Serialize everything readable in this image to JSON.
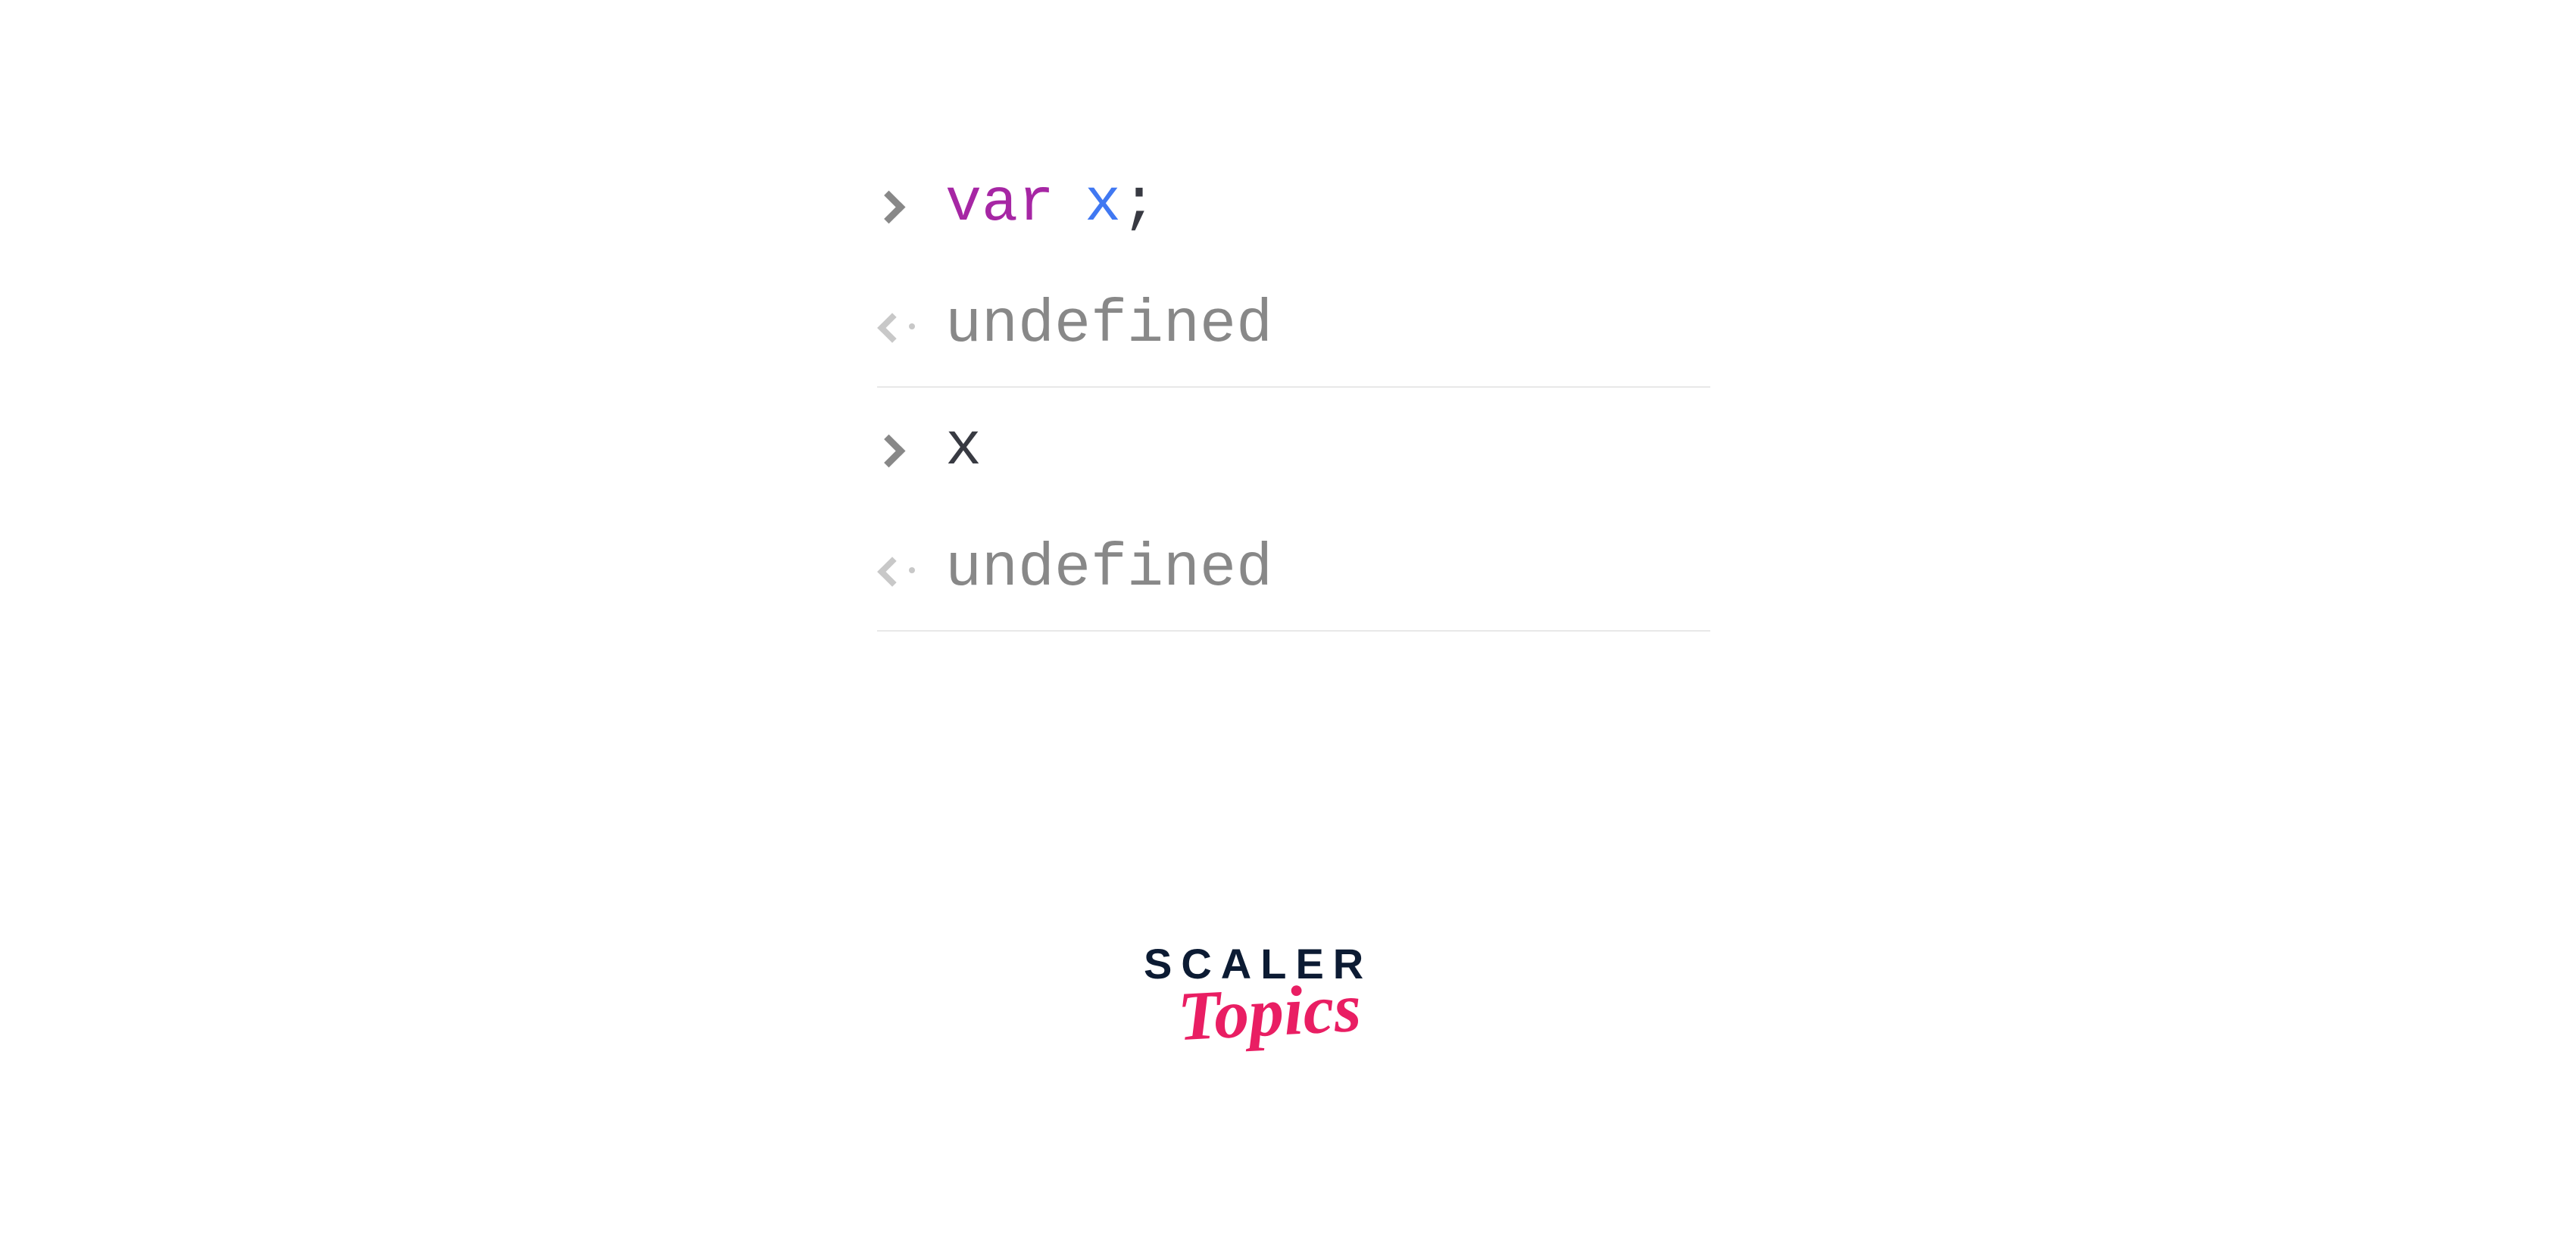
{
  "console": {
    "entries": [
      {
        "type": "input",
        "tokens": {
          "keyword": "var",
          "variable": "x",
          "punct": ";"
        }
      },
      {
        "type": "output",
        "text": "undefined"
      },
      {
        "type": "input",
        "tokens": {
          "plain": "x"
        }
      },
      {
        "type": "output",
        "text": "undefined"
      }
    ]
  },
  "branding": {
    "line1": "SCALER",
    "line2": "Topics"
  }
}
